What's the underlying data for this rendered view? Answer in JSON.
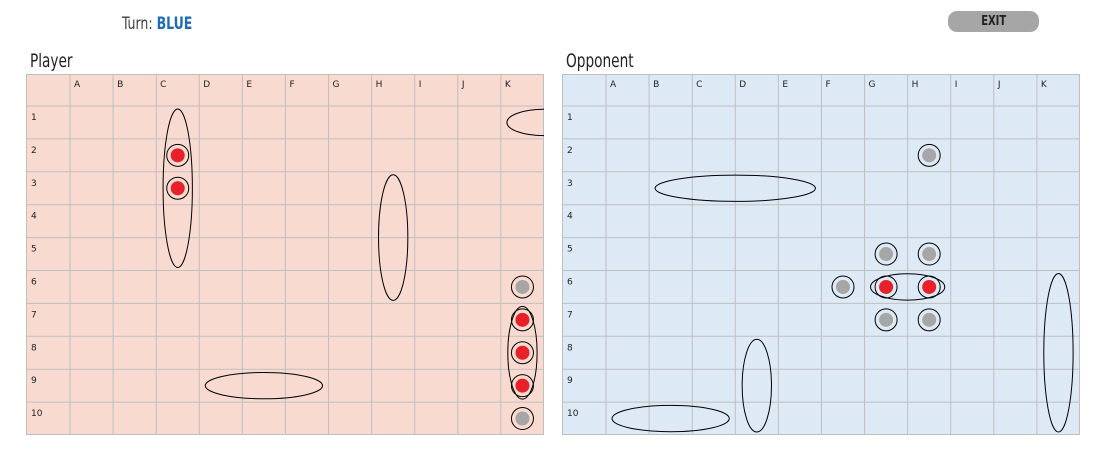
{
  "header": {
    "turn_label": "Turn:",
    "turn_value": "BLUE",
    "exit_label": "EXIT"
  },
  "colors": {
    "player_bg": "#f8dad0",
    "opponent_bg": "#dde9f5",
    "grid_line": "#bfbfbf",
    "hit": "#e8202a",
    "miss": "#a6a6a6",
    "turn_accent": "#1f6bb5"
  },
  "columns": [
    "A",
    "B",
    "C",
    "D",
    "E",
    "F",
    "G",
    "H",
    "I",
    "J",
    "K"
  ],
  "rows": [
    "1",
    "2",
    "3",
    "4",
    "5",
    "6",
    "7",
    "8",
    "9",
    "10"
  ],
  "boards": [
    {
      "key": "player",
      "title": "Player",
      "ships": [
        {
          "col": "K",
          "row": 1,
          "length": 2,
          "orientation": "horizontal"
        },
        {
          "col": "C",
          "row": 1,
          "length": 5,
          "orientation": "vertical"
        },
        {
          "col": "H",
          "row": 3,
          "length": 4,
          "orientation": "vertical"
        },
        {
          "col": "K",
          "row": 7,
          "length": 3,
          "orientation": "vertical"
        },
        {
          "col": "D",
          "row": 9,
          "length": 3,
          "orientation": "horizontal"
        }
      ],
      "shots": [
        {
          "col": "C",
          "row": 2,
          "result": "hit"
        },
        {
          "col": "C",
          "row": 3,
          "result": "hit"
        },
        {
          "col": "K",
          "row": 6,
          "result": "miss"
        },
        {
          "col": "K",
          "row": 7,
          "result": "hit"
        },
        {
          "col": "K",
          "row": 8,
          "result": "hit"
        },
        {
          "col": "K",
          "row": 9,
          "result": "hit"
        },
        {
          "col": "K",
          "row": 10,
          "result": "miss"
        }
      ]
    },
    {
      "key": "opponent",
      "title": "Opponent",
      "ships": [
        {
          "col": "B",
          "row": 3,
          "length": 4,
          "orientation": "horizontal"
        },
        {
          "col": "G",
          "row": 6,
          "length": 2,
          "orientation": "horizontal"
        },
        {
          "col": "K",
          "row": 6,
          "length": 5,
          "orientation": "vertical"
        },
        {
          "col": "D",
          "row": 8,
          "length": 3,
          "orientation": "vertical"
        },
        {
          "col": "A",
          "row": 10,
          "length": 3,
          "orientation": "horizontal"
        }
      ],
      "shots": [
        {
          "col": "H",
          "row": 2,
          "result": "miss"
        },
        {
          "col": "G",
          "row": 5,
          "result": "miss"
        },
        {
          "col": "H",
          "row": 5,
          "result": "miss"
        },
        {
          "col": "F",
          "row": 6,
          "result": "miss"
        },
        {
          "col": "G",
          "row": 6,
          "result": "hit"
        },
        {
          "col": "H",
          "row": 6,
          "result": "hit"
        },
        {
          "col": "G",
          "row": 7,
          "result": "miss"
        },
        {
          "col": "H",
          "row": 7,
          "result": "miss"
        }
      ]
    }
  ]
}
